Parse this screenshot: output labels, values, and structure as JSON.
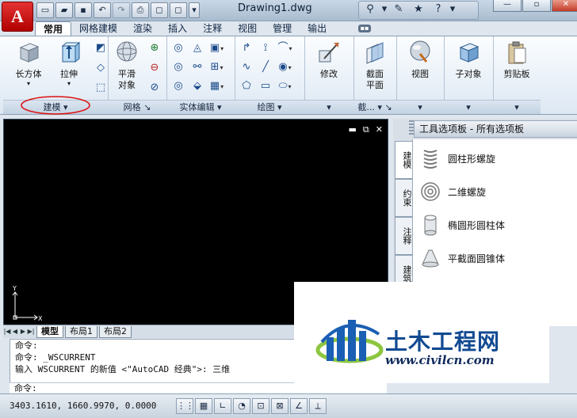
{
  "window": {
    "title": "Drawing1.dwg"
  },
  "app_logo_letter": "A",
  "ribbon": {
    "tabs": [
      "常用",
      "网格建模",
      "渲染",
      "插入",
      "注释",
      "视图",
      "管理",
      "输出"
    ],
    "active_tab": "常用",
    "panels": {
      "modeling": {
        "title": "建模",
        "buttons": [
          "长方体",
          "拉伸"
        ]
      },
      "mesh": {
        "title": "网格",
        "button": "平滑\n对象"
      },
      "solid_edit": {
        "title": "实体编辑"
      },
      "draw": {
        "title": "绘图"
      },
      "modify": {
        "button": "修改"
      },
      "section": {
        "title": "截...",
        "button": "截面\n平面"
      },
      "view": {
        "button": "视图"
      },
      "subobject": {
        "button": "子对象"
      },
      "clipboard": {
        "button": "剪贴板"
      }
    }
  },
  "drawing": {
    "ucs_y": "Y",
    "ucs_x": "X",
    "layout_tabs": [
      "模型",
      "布局1",
      "布局2"
    ]
  },
  "command": {
    "lines": [
      "命令:",
      "命令: _WSCURRENT",
      "输入 WSCURRENT 的新值 <\"AutoCAD 经典\">: 三维"
    ],
    "prompt": "命令:"
  },
  "status": {
    "coords": "3403.1610, 1660.9970, 0.0000"
  },
  "palette": {
    "header": "工具选项板 - 所有选项板",
    "vtabs": [
      "建模",
      "约束",
      "注释",
      "建筑"
    ],
    "items": [
      "圆柱形螺旋",
      "二维螺旋",
      "椭圆形圆柱体",
      "平截面圆锥体"
    ]
  },
  "watermark": {
    "text": "土木工程网",
    "url": "www.civilcn.com"
  },
  "colors": {
    "accent": "#c41e1e",
    "brand_blue": "#114a92"
  }
}
